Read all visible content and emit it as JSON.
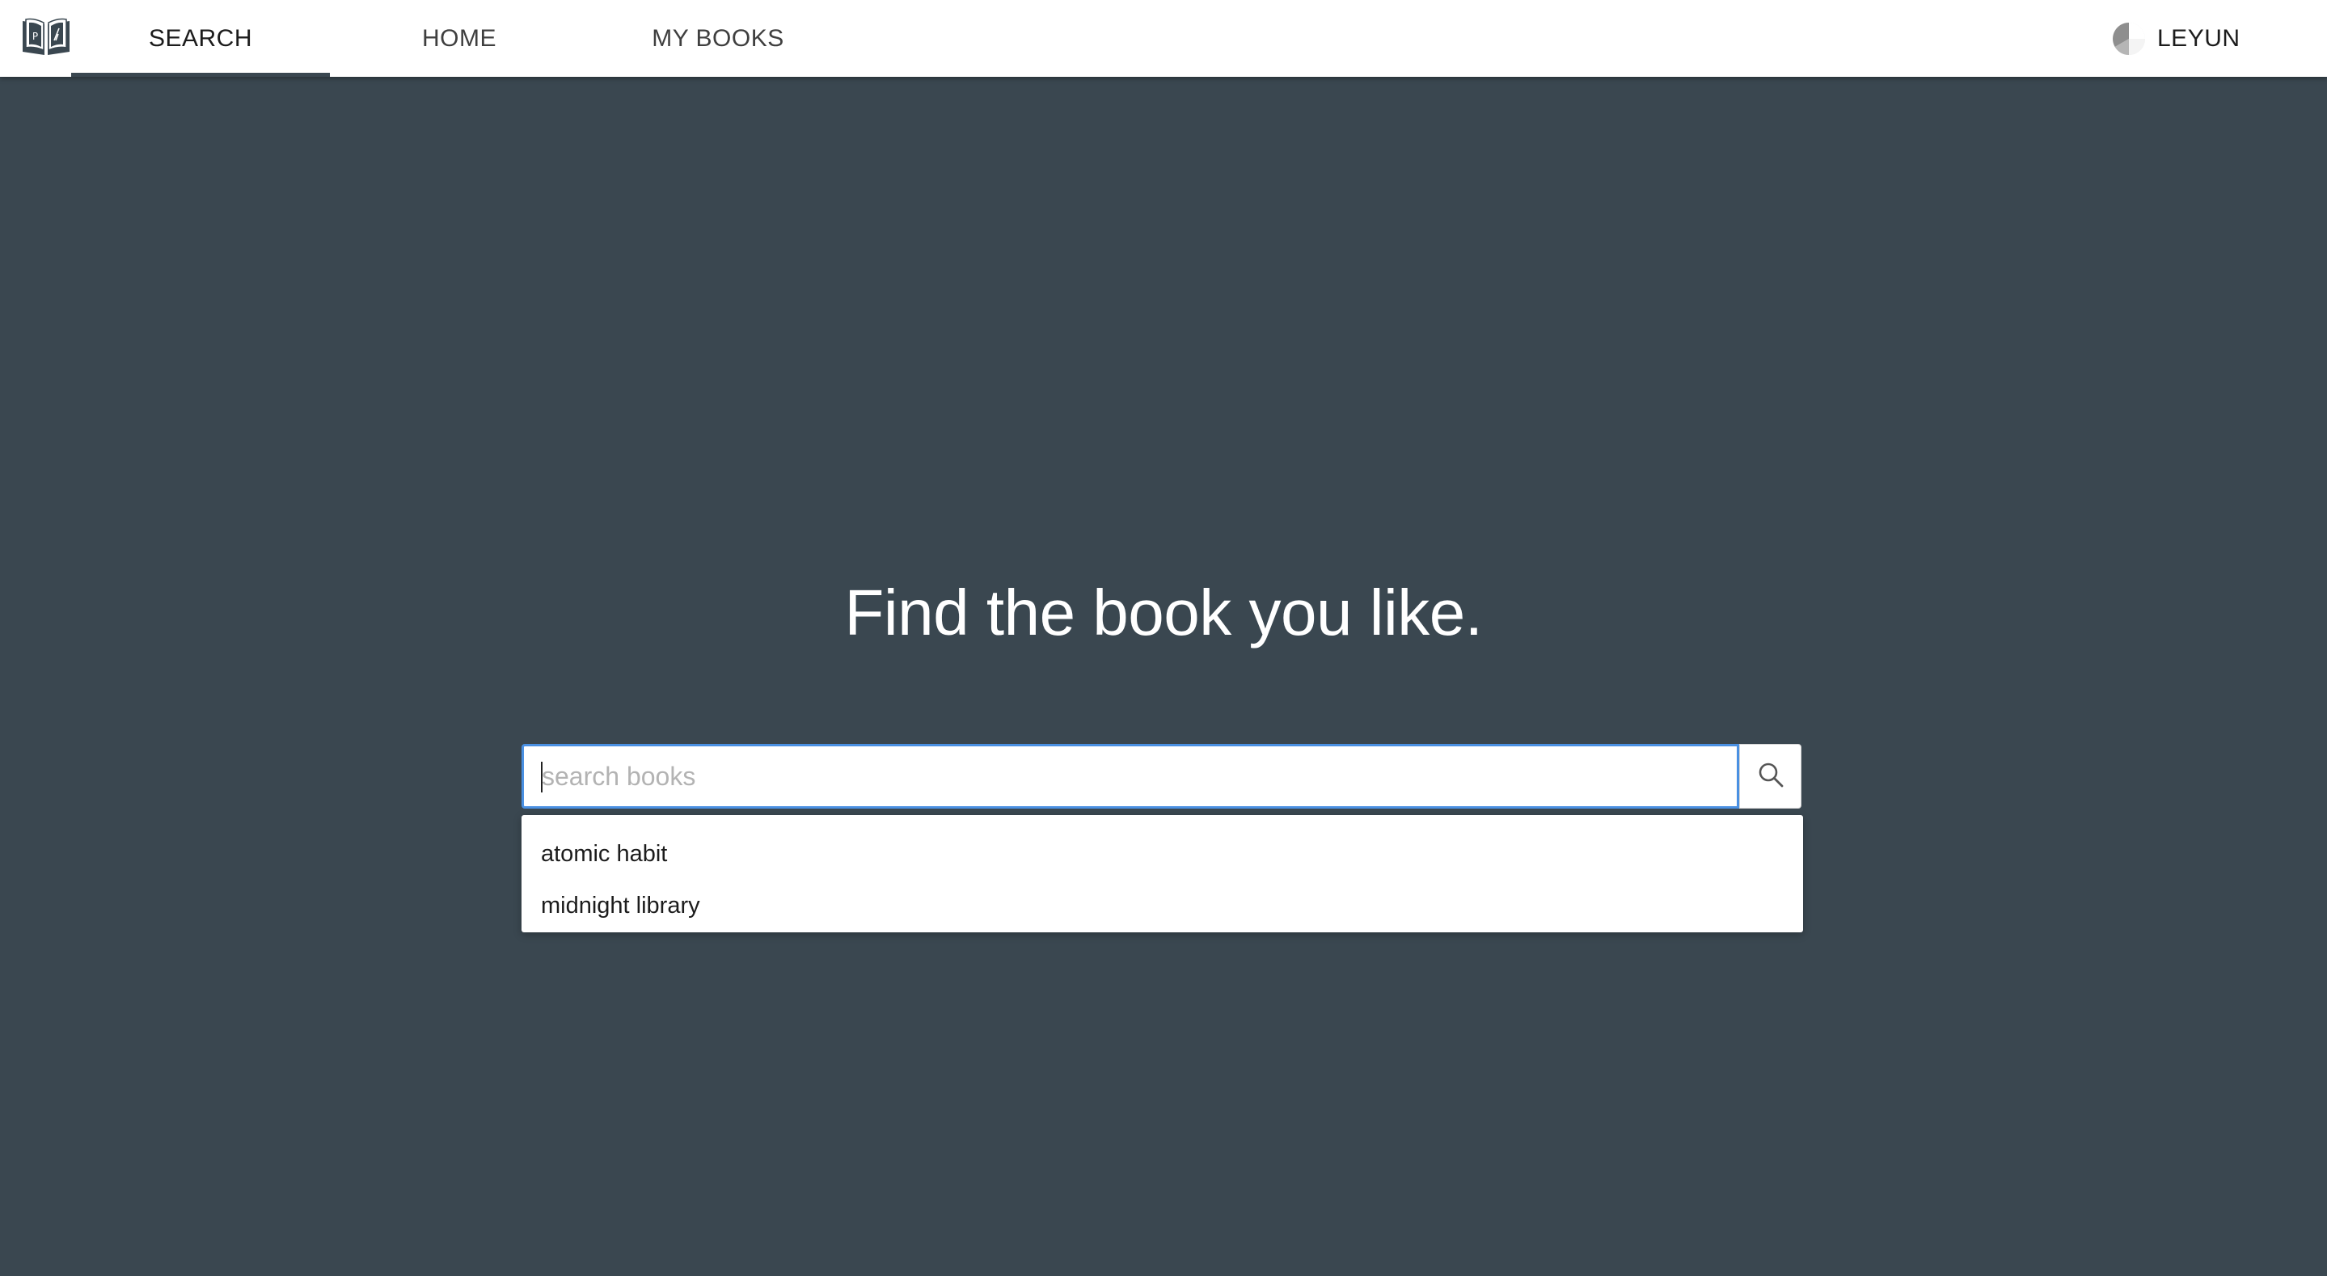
{
  "nav": {
    "logo_icon": "open-book-icon",
    "tabs": [
      {
        "label": "SEARCH",
        "active": true
      },
      {
        "label": "HOME",
        "active": false
      },
      {
        "label": "MY BOOKS",
        "active": false
      }
    ]
  },
  "user": {
    "icon": "user-avatar-icon",
    "name": "LEYUN"
  },
  "main": {
    "headline": "Find the book you like."
  },
  "search": {
    "placeholder": "search books",
    "value": "",
    "button_icon": "search-icon",
    "suggestions": [
      {
        "label": "atomic habit"
      },
      {
        "label": "midnight library"
      }
    ]
  },
  "colors": {
    "background": "#3a4750",
    "topbar": "#ffffff",
    "focus_border": "#4a90e2",
    "tab_indicator": "#3a4750"
  }
}
